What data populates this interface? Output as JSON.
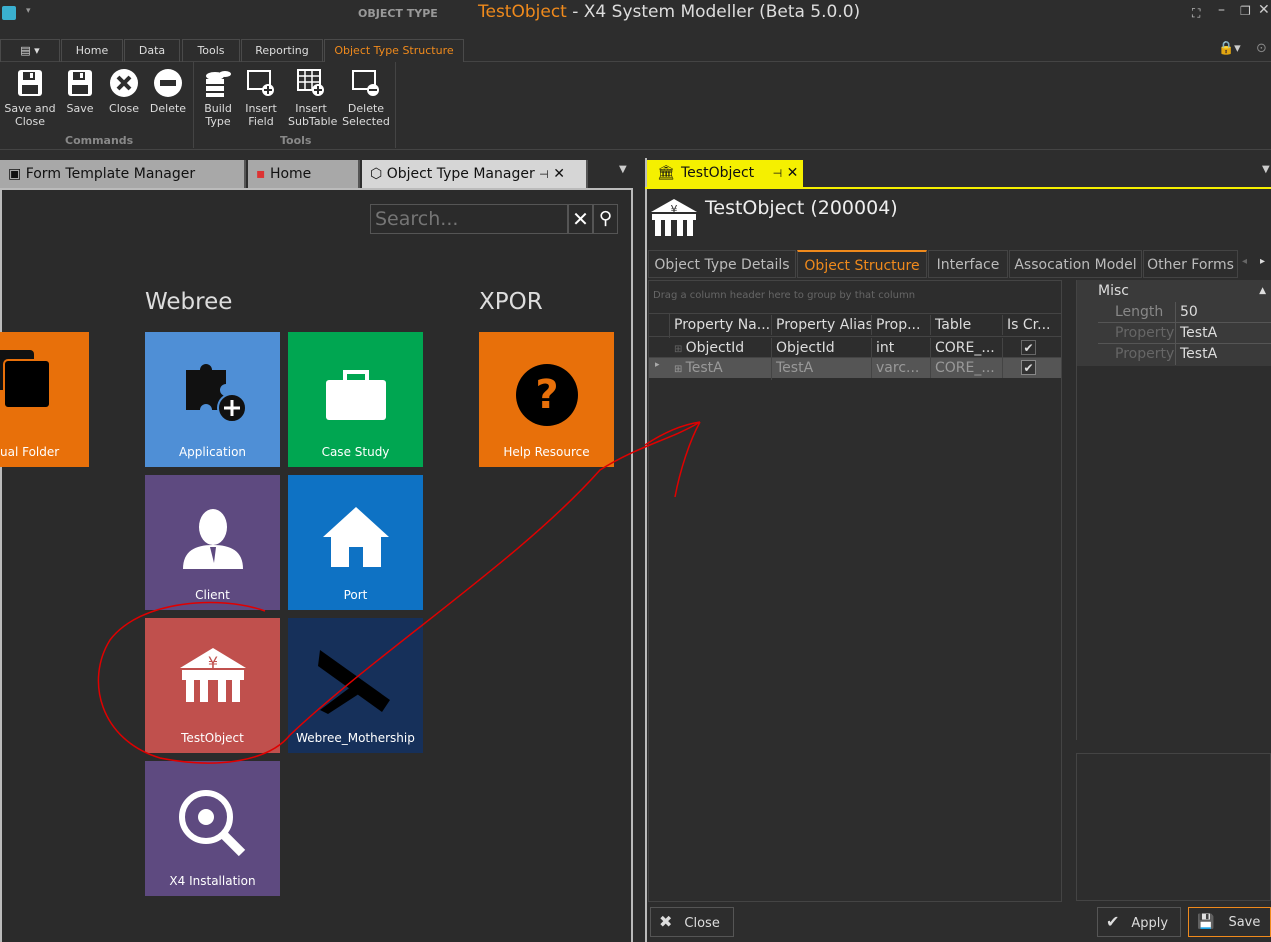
{
  "window": {
    "context": "OBJECT TYPE",
    "title_object": "TestObject",
    "title_rest": " - X4 System Modeller (Beta 5.0.0)"
  },
  "ribbon": {
    "tabs": [
      "Home",
      "Data",
      "Tools",
      "Reporting",
      "Object Type Structure"
    ],
    "active_tab": "Object Type Structure",
    "commands": [
      {
        "label": "Save and\nClose",
        "icon": "save-icon"
      },
      {
        "label": "Save",
        "icon": "save-icon"
      },
      {
        "label": "Close",
        "icon": "close-circle-icon"
      },
      {
        "label": "Delete",
        "icon": "minus-circle-icon"
      }
    ],
    "tools": [
      {
        "label": "Build\nType",
        "icon": "database-icon"
      },
      {
        "label": "Insert\nField",
        "icon": "insert-field-icon"
      },
      {
        "label": "Insert\nSubTable",
        "icon": "insert-subtable-icon"
      },
      {
        "label": "Delete\nSelected",
        "icon": "delete-selected-icon"
      }
    ],
    "groups": [
      "Commands",
      "Tools"
    ]
  },
  "doc_tabs": [
    "Form Template Manager",
    "Home",
    "Object Type Manager"
  ],
  "search": {
    "placeholder": "Search..."
  },
  "groups": [
    {
      "name": "Webree"
    },
    {
      "name": "XPOR"
    }
  ],
  "tiles": [
    {
      "label": "ual Folder",
      "color": "#e8700a"
    },
    {
      "label": "Application",
      "color": "#4f8fd6"
    },
    {
      "label": "Case Study",
      "color": "#00a651"
    },
    {
      "label": "Help Resource",
      "color": "#e8700a"
    },
    {
      "label": "Client",
      "color": "#5e4a80"
    },
    {
      "label": "Port",
      "color": "#0e72c4"
    },
    {
      "label": "TestObject",
      "color": "#c0504d"
    },
    {
      "label": "Webree_Mothership",
      "color": "#16305a"
    },
    {
      "label": "X4 Installation",
      "color": "#5e4a80"
    }
  ],
  "detail": {
    "tab": "TestObject",
    "heading": "TestObject (200004)",
    "tabs": [
      "Object Type Details",
      "Object Structure",
      "Interface",
      "Assocation Model",
      "Other Forms"
    ],
    "active_tab": "Object Structure",
    "group_hint": "Drag a column header here to group by that column",
    "columns": [
      "Property Na...",
      "Property Alias",
      "Prop...",
      "Table",
      "Is Cr..."
    ],
    "rows": [
      [
        "ObjectId",
        "ObjectId",
        "int",
        "CORE_...",
        true
      ],
      [
        "TestA",
        "TestA",
        "varc...",
        "CORE_...",
        true
      ]
    ],
    "props": {
      "category": "Misc",
      "items": [
        {
          "name": "Length",
          "value": "50"
        },
        {
          "name": "Property",
          "value": "TestA"
        },
        {
          "name": "Property",
          "value": "TestA"
        }
      ]
    },
    "buttons": {
      "close": "Close",
      "apply": "Apply",
      "save": "Save"
    }
  },
  "colors": {
    "accent": "#f08a1c",
    "active_doc_tab": "#f5f000",
    "annotation": "#e00000"
  }
}
